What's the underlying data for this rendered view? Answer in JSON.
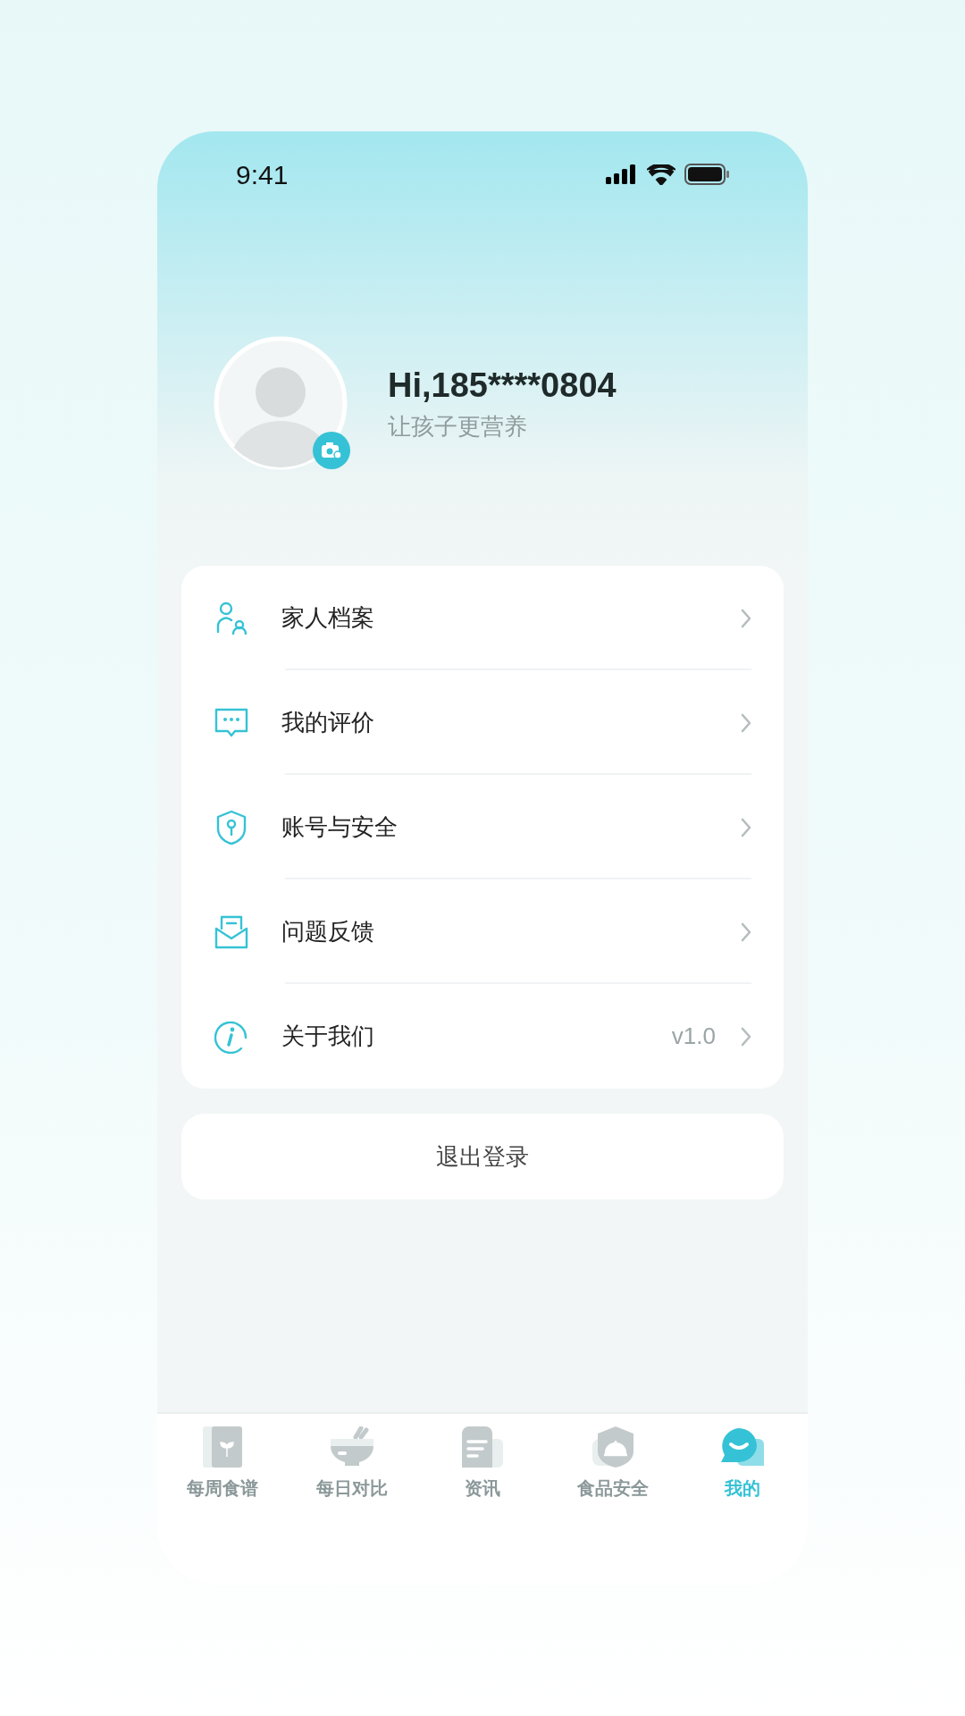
{
  "status_bar": {
    "time": "9:41"
  },
  "profile": {
    "greeting": "Hi,185****0804",
    "subtitle": "让孩子更营养"
  },
  "menu": [
    {
      "label": "家人档案"
    },
    {
      "label": "我的评价"
    },
    {
      "label": "账号与安全"
    },
    {
      "label": "问题反馈"
    },
    {
      "label": "关于我们",
      "value": "v1.0"
    }
  ],
  "logout_button": "退出登录",
  "tab_bar": [
    {
      "label": "每周食谱",
      "selected": false
    },
    {
      "label": "每日对比",
      "selected": false
    },
    {
      "label": "资讯",
      "selected": false
    },
    {
      "label": "食品安全",
      "selected": false
    },
    {
      "label": "我的",
      "selected": true
    }
  ]
}
